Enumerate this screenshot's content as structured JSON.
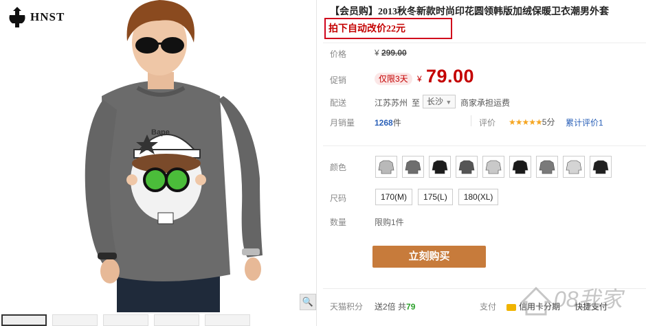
{
  "brand": {
    "name": "HNST"
  },
  "product": {
    "title": "【会员购】2013秋冬新款时尚印花圆领韩版加绒保暖卫衣潮男外套",
    "promo": "拍下自动改价22元"
  },
  "price": {
    "label": "价格",
    "currency": "¥",
    "original": "299.00"
  },
  "promotion": {
    "label": "促销",
    "badge": "仅限3天",
    "currency": "¥",
    "value": "79.00"
  },
  "shipping": {
    "label": "配送",
    "from": "江苏苏州",
    "to_word": "至",
    "dest": "长沙",
    "note": "商家承担运费"
  },
  "sales": {
    "label": "月销量",
    "count": "1268",
    "unit": "件",
    "rating_label": "评价",
    "stars": "★★★★★",
    "score": "5分",
    "reviews_link": "累计评价1"
  },
  "options": {
    "color_label": "颜色",
    "size_label": "尺码",
    "qty_label": "数量",
    "qty_limit": "限购1件",
    "colors": [
      "#b9b9b9",
      "#6e6e6e",
      "#1c1c1c",
      "#555555",
      "#c9c9c9",
      "#1a1a1a",
      "#7a7a7a",
      "#d4d4d4",
      "#202020"
    ],
    "sizes": [
      "170(M)",
      "175(L)",
      "180(XL)"
    ]
  },
  "actions": {
    "buy_now": "立刻购买"
  },
  "footer": {
    "points_label": "天猫积分",
    "points_text": "送2倍 共",
    "points_value": "79",
    "pay_label": "支付",
    "credit": "信用卡分期",
    "quick_pay": "快捷支付"
  },
  "watermark": {
    "text": "08我家"
  },
  "icons": {
    "zoom": "magnifier-icon",
    "dropdown": "chevron-down-icon"
  }
}
